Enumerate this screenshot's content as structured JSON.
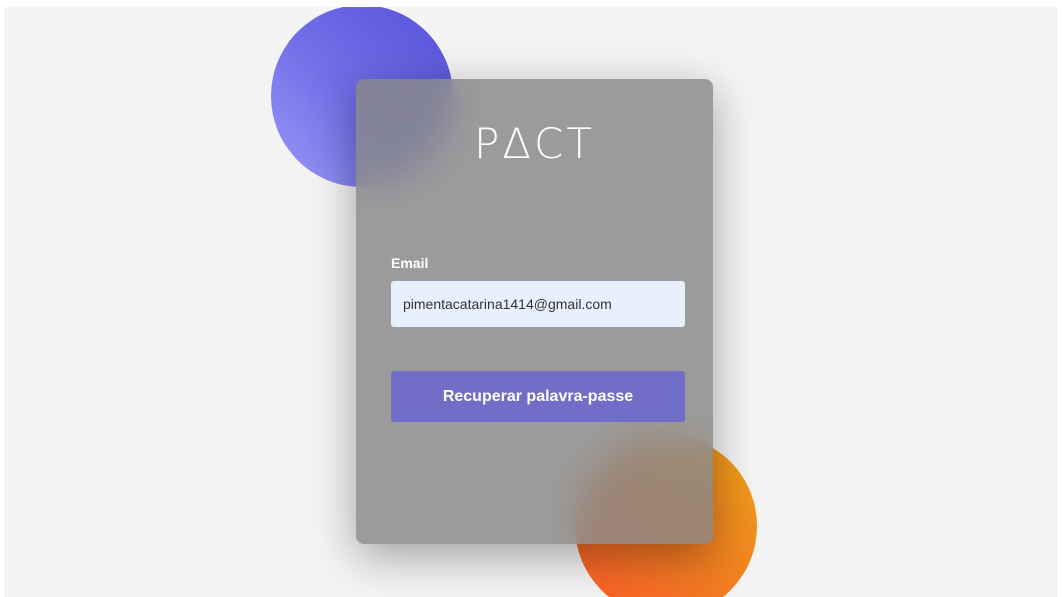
{
  "card": {
    "logo_text": "PΔCT",
    "email_label": "Email",
    "email_value": "pimentacatarina1414@gmail.com",
    "recover_button_label": "Recuperar palavra-passe"
  },
  "colors": {
    "page_background": "#f4f4f4",
    "card_background": "#878787",
    "input_background": "#e8f0fe",
    "button_background": "#716ec8",
    "blob_blue": "#5552d9",
    "blob_orange": "#f27d22"
  }
}
